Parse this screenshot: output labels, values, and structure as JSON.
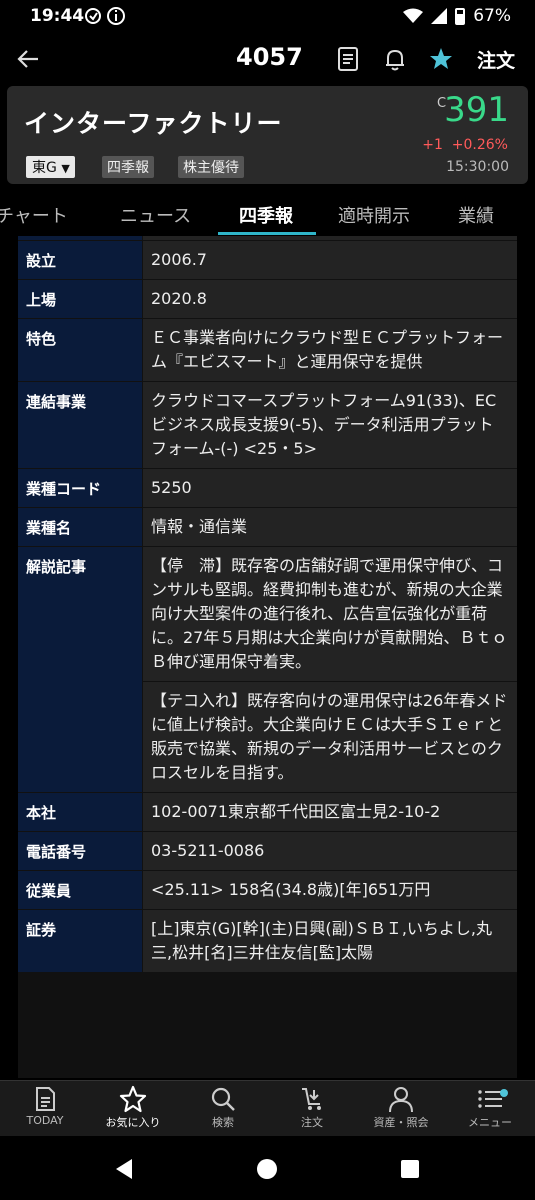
{
  "status": {
    "time": "19:44",
    "battery": "67%"
  },
  "header": {
    "code": "4057",
    "order": "注文"
  },
  "stock": {
    "name": "インターファクトリー",
    "market": "東G",
    "tags": [
      "四季報",
      "株主優待"
    ],
    "price_prefix": "C",
    "price": "391",
    "change": "+1",
    "change_pct": "+0.26%",
    "time": "15:30:00",
    "colors": {
      "price": "#39d98a",
      "change": "#ff5a5a"
    }
  },
  "tabs": [
    "チャート",
    "ニュース",
    "四季報",
    "適時開示",
    "業績"
  ],
  "active_tab": "四季報",
  "rows": [
    {
      "label": "設立",
      "values": [
        "2006.7"
      ]
    },
    {
      "label": "上場",
      "values": [
        "2020.8"
      ]
    },
    {
      "label": "特色",
      "values": [
        "ＥＣ事業者向けにクラウド型ＥＣプラットフォーム『エビスマート』と運用保守を提供"
      ]
    },
    {
      "label": "連結事業",
      "values": [
        "クラウドコマースプラットフォーム91(33)、ECビジネス成長支援9(-5)、データ利活用プラットフォーム-(-) <25・5>"
      ]
    },
    {
      "label": "業種コード",
      "values": [
        "5250"
      ]
    },
    {
      "label": "業種名",
      "values": [
        "情報・通信業"
      ]
    },
    {
      "label": "解説記事",
      "values": [
        "【停　滞】既存客の店舗好調で運用保守伸び、コンサルも堅調。経費抑制も進むが、新規の大企業向け大型案件の進行後れ、広告宣伝強化が重荷に。27年５月期は大企業向けが貢献開始、ＢｔｏＢ伸び運用保守着実。",
        "【テコ入れ】既存客向けの運用保守は26年春メドに値上げ検討。大企業向けＥＣは大手ＳＩｅｒと販売で協業、新規のデータ利活用サービスとのクロスセルを目指す。"
      ]
    },
    {
      "label": "本社",
      "values": [
        "102-0071東京都千代田区富士見2-10-2"
      ]
    },
    {
      "label": "電話番号",
      "values": [
        "03-5211-0086"
      ]
    },
    {
      "label": "従業員",
      "values": [
        "<25.11> 158名(34.8歳)[年]651万円"
      ]
    },
    {
      "label": "証券",
      "values": [
        "[上]東京(G)[幹](主)日興(副)ＳＢＩ,いちよし,丸三,松井[名]三井住友信[監]太陽"
      ]
    }
  ],
  "bottom_nav": [
    {
      "label": "TODAY",
      "icon": "document-icon"
    },
    {
      "label": "お気に入り",
      "icon": "star-icon"
    },
    {
      "label": "検索",
      "icon": "search-icon"
    },
    {
      "label": "注文",
      "icon": "cart-icon"
    },
    {
      "label": "資産・照会",
      "icon": "person-icon"
    },
    {
      "label": "メニュー",
      "icon": "menu-icon"
    }
  ],
  "active_nav": "お気に入り"
}
